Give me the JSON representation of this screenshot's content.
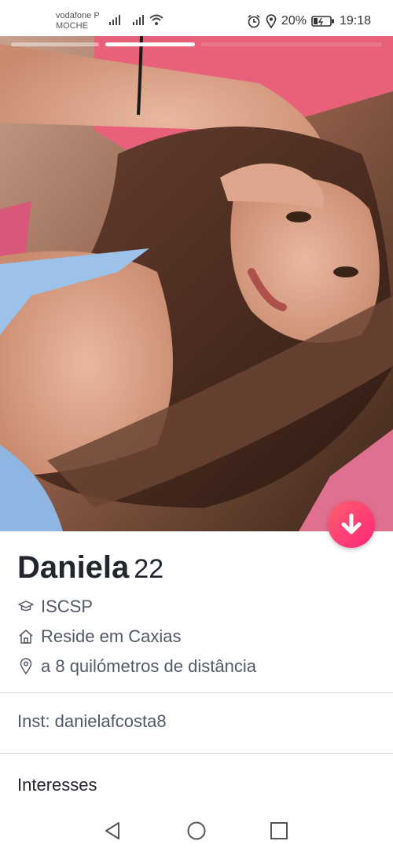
{
  "status_bar": {
    "carrier_line1": "vodafone P",
    "carrier_line2": "MOCHE",
    "battery": "20%",
    "time": "19:18"
  },
  "profile": {
    "name": "Daniela",
    "age": "22",
    "school": "ISCSP",
    "residence": "Reside em Caxias",
    "distance": "a 8 quilómetros de distância",
    "bio": "Inst: danielafcosta8",
    "interests_title": "Interesses"
  },
  "photo": {
    "total": 3,
    "current": 2
  },
  "icons": {
    "school": "graduation-cap-icon",
    "home": "house-icon",
    "location": "location-pin-icon",
    "collapse": "arrow-down-icon"
  },
  "colors": {
    "accent_start": "#ff5f6d",
    "accent_end": "#fd267a",
    "text_primary": "#21262e",
    "text_secondary": "#505965"
  }
}
